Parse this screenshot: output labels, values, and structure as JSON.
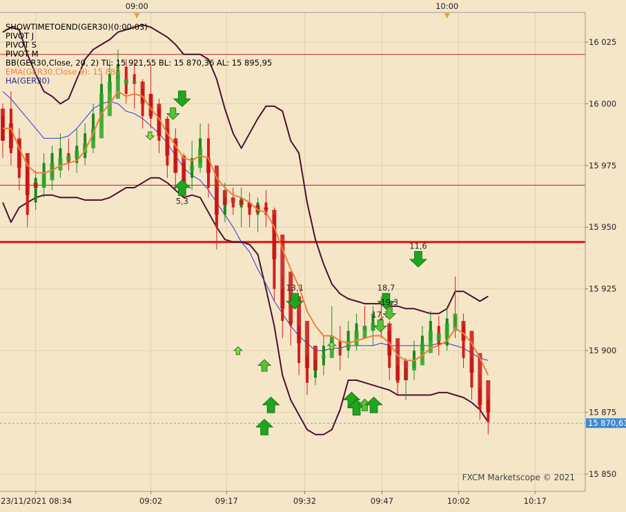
{
  "chart_data": {
    "type": "candlestick",
    "instrument": "GER30",
    "legend": [
      {
        "text": "SHOWTIMETOEND(GER30)(0:00:03)",
        "color": "#000000"
      },
      {
        "text": "PIVOT J",
        "color": "#000000"
      },
      {
        "text": "PIVOT S",
        "color": "#000000"
      },
      {
        "text": "PIVOT M",
        "color": "#000000"
      },
      {
        "text": "BB(GER30,Close, 20, 2)  TL: 15 921,55  BL: 15 870,36  AL: 15 895,95",
        "color": "#000000"
      },
      {
        "text": "EMA(GER30,Close,9): 15 889",
        "color": "#f07f3c"
      },
      {
        "text": "HA(GER30)",
        "color": "#2a2a8a"
      }
    ],
    "watermark": "FXCM Marketscope © 2021",
    "y_ticks": [
      15850,
      15875,
      15900,
      15925,
      15950,
      15975,
      16000,
      16025
    ],
    "y_tick_labels": [
      "15 850",
      "15 875",
      "15 900",
      "15 925",
      "15 950",
      "15 975",
      "16 000",
      "16 025"
    ],
    "ylim": [
      15843,
      16037
    ],
    "x_tick_labels": [
      {
        "label": "23/11/2021 08:34",
        "bar": 4
      },
      {
        "label": "09:02",
        "bar": 18
      },
      {
        "label": "09:17",
        "bar": 27.2
      },
      {
        "label": "09:32",
        "bar": 36.7
      },
      {
        "label": "09:47",
        "bar": 46.1
      },
      {
        "label": "10:02",
        "bar": 55.4
      },
      {
        "label": "10:17",
        "bar": 64.7
      }
    ],
    "session_markers": [
      {
        "label": "09:00",
        "bar": 16.3
      },
      {
        "label": "10:00",
        "bar": 54.0
      }
    ],
    "pivot_lines": [
      {
        "name": "pivot-line-upper",
        "value": 16020,
        "color": "#b02020",
        "width": 1
      },
      {
        "name": "pivot-line-middle",
        "value": 15967,
        "color": "#b02020",
        "width": 1
      },
      {
        "name": "pivot-line-main",
        "value": 15944,
        "color": "#e01010",
        "width": 3
      }
    ],
    "current_price": {
      "value": 15870.61,
      "label": "15 870,61"
    },
    "candles": [
      {
        "o": 15995,
        "h": 16000,
        "l": 15978,
        "c": 15985
      },
      {
        "o": 15998,
        "h": 16005,
        "l": 15975,
        "c": 15980
      },
      {
        "o": 15985,
        "h": 15990,
        "l": 15965,
        "c": 15970
      },
      {
        "o": 15975,
        "h": 15980,
        "l": 15950,
        "c": 15955
      },
      {
        "o": 15960,
        "h": 15973,
        "l": 15957,
        "c": 15970
      },
      {
        "o": 15966,
        "h": 15980,
        "l": 15962,
        "c": 15976
      },
      {
        "o": 15970,
        "h": 15983,
        "l": 15965,
        "c": 15980
      },
      {
        "o": 15975,
        "h": 15988,
        "l": 15970,
        "c": 15982
      },
      {
        "o": 15980,
        "h": 15986,
        "l": 15973,
        "c": 15976
      },
      {
        "o": 15976,
        "h": 15990,
        "l": 15972,
        "c": 15983
      },
      {
        "o": 15978,
        "h": 15992,
        "l": 15975,
        "c": 15988
      },
      {
        "o": 15985,
        "h": 16000,
        "l": 15980,
        "c": 15996
      },
      {
        "o": 15995,
        "h": 16012,
        "l": 15990,
        "c": 16008
      },
      {
        "o": 16005,
        "h": 16018,
        "l": 16000,
        "c": 16012
      },
      {
        "o": 16010,
        "h": 16022,
        "l": 16005,
        "c": 16016
      },
      {
        "o": 16015,
        "h": 16018,
        "l": 16000,
        "c": 16004
      },
      {
        "o": 16012,
        "h": 16018,
        "l": 15998,
        "c": 16008
      },
      {
        "o": 16006,
        "h": 16010,
        "l": 15990,
        "c": 15995
      },
      {
        "o": 16004,
        "h": 16016,
        "l": 15990,
        "c": 15994
      },
      {
        "o": 15998,
        "h": 16002,
        "l": 15980,
        "c": 15985
      },
      {
        "o": 15990,
        "h": 15995,
        "l": 15970,
        "c": 15975
      },
      {
        "o": 15985,
        "h": 15990,
        "l": 15965,
        "c": 15972
      },
      {
        "o": 15976,
        "h": 15980,
        "l": 15962,
        "c": 15968
      },
      {
        "o": 15970,
        "h": 15985,
        "l": 15965,
        "c": 15978
      },
      {
        "o": 15976,
        "h": 15992,
        "l": 15972,
        "c": 15986
      },
      {
        "o": 15986,
        "h": 15992,
        "l": 15962,
        "c": 15966
      },
      {
        "o": 15966,
        "h": 15972,
        "l": 15941,
        "c": 15950
      },
      {
        "o": 15955,
        "h": 15968,
        "l": 15952,
        "c": 15962
      },
      {
        "o": 15960,
        "h": 15966,
        "l": 15955,
        "c": 15958
      },
      {
        "o": 15958,
        "h": 15966,
        "l": 15950,
        "c": 15962
      },
      {
        "o": 15960,
        "h": 15964,
        "l": 15950,
        "c": 15955
      },
      {
        "o": 15955,
        "h": 15962,
        "l": 15948,
        "c": 15960
      },
      {
        "o": 15960,
        "h": 15965,
        "l": 15950,
        "c": 15955
      },
      {
        "o": 15955,
        "h": 15958,
        "l": 15920,
        "c": 15925
      },
      {
        "o": 15925,
        "h": 15930,
        "l": 15905,
        "c": 15912
      },
      {
        "o": 15912,
        "h": 15920,
        "l": 15902,
        "c": 15910
      },
      {
        "o": 15910,
        "h": 15915,
        "l": 15890,
        "c": 15895
      },
      {
        "o": 15898,
        "h": 15905,
        "l": 15882,
        "c": 15887
      },
      {
        "o": 15889,
        "h": 15899,
        "l": 15886,
        "c": 15896
      },
      {
        "o": 15894,
        "h": 15906,
        "l": 15890,
        "c": 15902
      },
      {
        "o": 15902,
        "h": 15918,
        "l": 15897,
        "c": 15905
      },
      {
        "o": 15904,
        "h": 15910,
        "l": 15892,
        "c": 15898
      },
      {
        "o": 15900,
        "h": 15912,
        "l": 15897,
        "c": 15908
      },
      {
        "o": 15905,
        "h": 15915,
        "l": 15900,
        "c": 15911
      },
      {
        "o": 15910,
        "h": 15918,
        "l": 15905,
        "c": 15908
      },
      {
        "o": 15908,
        "h": 15918,
        "l": 15902,
        "c": 15915
      },
      {
        "o": 15913,
        "h": 15922,
        "l": 15905,
        "c": 15908
      },
      {
        "o": 15908,
        "h": 15912,
        "l": 15888,
        "c": 15893
      },
      {
        "o": 15894,
        "h": 15900,
        "l": 15882,
        "c": 15887
      },
      {
        "o": 15888,
        "h": 15897,
        "l": 15880,
        "c": 15893
      },
      {
        "o": 15893,
        "h": 15904,
        "l": 15888,
        "c": 15900
      },
      {
        "o": 15900,
        "h": 15910,
        "l": 15895,
        "c": 15906
      },
      {
        "o": 15904,
        "h": 15916,
        "l": 15900,
        "c": 15912
      },
      {
        "o": 15910,
        "h": 15914,
        "l": 15898,
        "c": 15902
      },
      {
        "o": 15902,
        "h": 15918,
        "l": 15900,
        "c": 15913
      },
      {
        "o": 15914,
        "h": 15930,
        "l": 15905,
        "c": 15910
      },
      {
        "o": 15910,
        "h": 15915,
        "l": 15893,
        "c": 15897
      },
      {
        "o": 15897,
        "h": 15903,
        "l": 15880,
        "c": 15885
      },
      {
        "o": 15885,
        "h": 15890,
        "l": 15872,
        "c": 15876
      },
      {
        "o": 15880,
        "h": 15882,
        "l": 15866,
        "c": 15871
      }
    ],
    "heikin_ashi": [
      {
        "bar": 0,
        "o": 15998,
        "c": 15985
      },
      {
        "bar": 1,
        "o": 15992,
        "c": 15982
      },
      {
        "bar": 2,
        "o": 15986,
        "c": 15974
      },
      {
        "bar": 3,
        "o": 15980,
        "c": 15963
      },
      {
        "bar": 4,
        "o": 15968,
        "c": 15966
      },
      {
        "bar": 5,
        "o": 15966,
        "c": 15972
      },
      {
        "bar": 6,
        "o": 15969,
        "c": 15976
      },
      {
        "bar": 7,
        "o": 15973,
        "c": 15978
      },
      {
        "bar": 8,
        "o": 15977,
        "c": 15979
      },
      {
        "bar": 9,
        "o": 15978,
        "c": 15981
      },
      {
        "bar": 10,
        "o": 15980,
        "c": 15984
      },
      {
        "bar": 11,
        "o": 15982,
        "c": 15990
      },
      {
        "bar": 12,
        "o": 15986,
        "c": 16004
      },
      {
        "bar": 13,
        "o": 15995,
        "c": 16009
      },
      {
        "bar": 14,
        "o": 16002,
        "c": 16013
      },
      {
        "bar": 15,
        "o": 16008,
        "c": 16010
      },
      {
        "bar": 16,
        "o": 16009,
        "c": 16009
      },
      {
        "bar": 17,
        "o": 16009,
        "c": 16000
      },
      {
        "bar": 18,
        "o": 16004,
        "c": 15995
      },
      {
        "bar": 19,
        "o": 16000,
        "c": 15987
      },
      {
        "bar": 20,
        "o": 15994,
        "c": 15979
      },
      {
        "bar": 21,
        "o": 15986,
        "c": 15972
      },
      {
        "bar": 22,
        "o": 15979,
        "c": 15968
      },
      {
        "bar": 23,
        "o": 15973,
        "c": 15975
      },
      {
        "bar": 24,
        "o": 15974,
        "c": 15982
      },
      {
        "bar": 25,
        "o": 15978,
        "c": 15972
      },
      {
        "bar": 26,
        "o": 15975,
        "c": 15955
      },
      {
        "bar": 27,
        "o": 15965,
        "c": 15959
      },
      {
        "bar": 28,
        "o": 15962,
        "c": 15960
      },
      {
        "bar": 29,
        "o": 15961,
        "c": 15959
      },
      {
        "bar": 30,
        "o": 15960,
        "c": 15958
      },
      {
        "bar": 31,
        "o": 15959,
        "c": 15956
      },
      {
        "bar": 32,
        "o": 15958,
        "c": 15957
      },
      {
        "bar": 33,
        "o": 15957,
        "c": 15937
      },
      {
        "bar": 34,
        "o": 15947,
        "c": 15917
      },
      {
        "bar": 35,
        "o": 15932,
        "c": 15911
      },
      {
        "bar": 36,
        "o": 15922,
        "c": 15903
      },
      {
        "bar": 37,
        "o": 15912,
        "c": 15893
      },
      {
        "bar": 38,
        "o": 15902,
        "c": 15892
      },
      {
        "bar": 39,
        "o": 15897,
        "c": 15898
      },
      {
        "bar": 40,
        "o": 15897,
        "c": 15906
      },
      {
        "bar": 41,
        "o": 15901,
        "c": 15901
      },
      {
        "bar": 42,
        "o": 15901,
        "c": 15904
      },
      {
        "bar": 43,
        "o": 15902,
        "c": 15908
      },
      {
        "bar": 44,
        "o": 15905,
        "c": 15910
      },
      {
        "bar": 45,
        "o": 15908,
        "c": 15911
      },
      {
        "bar": 46,
        "o": 15910,
        "c": 15912
      },
      {
        "bar": 47,
        "o": 15911,
        "c": 15898
      },
      {
        "bar": 48,
        "o": 15905,
        "c": 15888
      },
      {
        "bar": 49,
        "o": 15896,
        "c": 15888
      },
      {
        "bar": 50,
        "o": 15892,
        "c": 15896
      },
      {
        "bar": 51,
        "o": 15894,
        "c": 15903
      },
      {
        "bar": 52,
        "o": 15899,
        "c": 15908
      },
      {
        "bar": 53,
        "o": 15904,
        "c": 15907
      },
      {
        "bar": 54,
        "o": 15905,
        "c": 15911
      },
      {
        "bar": 55,
        "o": 15908,
        "c": 15915
      },
      {
        "bar": 56,
        "o": 15912,
        "c": 15904
      },
      {
        "bar": 57,
        "o": 15908,
        "c": 15891
      },
      {
        "bar": 58,
        "o": 15899,
        "c": 15878
      },
      {
        "bar": 59,
        "o": 15888,
        "c": 15875
      }
    ],
    "bb_upper": [
      16029,
      16031,
      16030,
      16020,
      16012,
      16005,
      16003,
      16000,
      16002,
      16010,
      16018,
      16022,
      16024,
      16026,
      16029,
      16030,
      16031,
      16032,
      16031,
      16029,
      16027,
      16024,
      16020,
      16020,
      16020,
      16018,
      16010,
      15998,
      15988,
      15982,
      15988,
      15994,
      15999,
      15999,
      15997,
      15985,
      15980,
      15960,
      15945,
      15935,
      15927,
      15923,
      15921,
      15920,
      15919,
      15919,
      15919,
      15918,
      15918,
      15917,
      15917,
      15916,
      15915,
      15915,
      15917,
      15924,
      15924,
      15922,
      15920,
      15922
    ],
    "bb_lower": [
      15960,
      15952,
      15958,
      15960,
      15962,
      15963,
      15963,
      15962,
      15962,
      15962,
      15961,
      15961,
      15961,
      15962,
      15964,
      15966,
      15966,
      15968,
      15970,
      15970,
      15968,
      15965,
      15962,
      15963,
      15962,
      15956,
      15950,
      15945,
      15944,
      15944,
      15943,
      15939,
      15925,
      15910,
      15890,
      15880,
      15874,
      15868,
      15866,
      15866,
      15868,
      15876,
      15888,
      15888,
      15887,
      15886,
      15885,
      15884,
      15882,
      15882,
      15882,
      15882,
      15882,
      15883,
      15883,
      15882,
      15881,
      15879,
      15876,
      15871
    ],
    "ema9": [
      15990,
      15990,
      15982,
      15975,
      15972,
      15972,
      15973,
      15975,
      15976,
      15977,
      15981,
      15988,
      15996,
      16000,
      16005,
      16003,
      16004,
      16003,
      15998,
      15994,
      15988,
      15983,
      15978,
      15977,
      15979,
      15978,
      15970,
      15966,
      15963,
      15962,
      15960,
      15957,
      15956,
      15950,
      15941,
      15933,
      15926,
      15916,
      15910,
      15906,
      15906,
      15904,
      15903,
      15904,
      15905,
      15906,
      15906,
      15903,
      15898,
      15896,
      15896,
      15898,
      15901,
      15902,
      15904,
      15909,
      15907,
      15903,
      15897,
      15890
    ],
    "sma": [
      16005,
      16002,
      15998,
      15994,
      15990,
      15986,
      15986,
      15986,
      15987,
      15990,
      15994,
      15998,
      16000,
      16001,
      16000,
      15997,
      15996,
      15994,
      15991,
      15988,
      15984,
      15979,
      15974,
      15971,
      15969,
      15965,
      15960,
      15955,
      15950,
      15944,
      15940,
      15933,
      15927,
      15920,
      15915,
      15910,
      15906,
      15903,
      15900,
      15900,
      15901,
      15901,
      15902,
      15902,
      15902,
      15902,
      15903,
      15902,
      15902,
      15902,
      15902,
      15902,
      15902,
      15903,
      15903,
      15902,
      15901,
      15899,
      15897,
      15896
    ],
    "signals": [
      {
        "bar": 21.8,
        "dir": "up",
        "size": "medium",
        "value": 15966,
        "label": "5,3"
      },
      {
        "bar": 21.8,
        "dir": "down",
        "size": "medium",
        "value": 16002,
        "label": ""
      },
      {
        "bar": 20.7,
        "dir": "down",
        "size": "small",
        "value": 15996,
        "label": ""
      },
      {
        "bar": 17.9,
        "dir": "down",
        "size": "tiny",
        "value": 15987,
        "label": ""
      },
      {
        "bar": 28.6,
        "dir": "up",
        "size": "tiny",
        "value": 15900,
        "label": ""
      },
      {
        "bar": 31.8,
        "dir": "up",
        "size": "small",
        "value": 15894,
        "label": ""
      },
      {
        "bar": 32.6,
        "dir": "up",
        "size": "medium",
        "value": 15878,
        "label": ""
      },
      {
        "bar": 31.8,
        "dir": "up",
        "size": "medium",
        "value": 15869,
        "label": ""
      },
      {
        "bar": 35.5,
        "dir": "down",
        "size": "medium",
        "value": 15920,
        "label": "13,1"
      },
      {
        "bar": 40.0,
        "dir": "up",
        "size": "tiny",
        "value": 15902,
        "label": ""
      },
      {
        "bar": 42.4,
        "dir": "up",
        "size": "medium",
        "value": 15880,
        "label": ""
      },
      {
        "bar": 43.0,
        "dir": "up",
        "size": "medium",
        "value": 15877,
        "label": ""
      },
      {
        "bar": 44.0,
        "dir": "up",
        "size": "small",
        "value": 15878,
        "label": ""
      },
      {
        "bar": 45.1,
        "dir": "up",
        "size": "medium",
        "value": 15878,
        "label": ""
      },
      {
        "bar": 45.9,
        "dir": "down",
        "size": "small",
        "value": 15910,
        "label": "17,7"
      },
      {
        "bar": 46.6,
        "dir": "down",
        "size": "medium",
        "value": 15920,
        "label": "18,7"
      },
      {
        "bar": 47.0,
        "dir": "down",
        "size": "small",
        "value": 15915,
        "label": "19,3"
      },
      {
        "bar": 50.5,
        "dir": "down",
        "size": "medium",
        "value": 15937,
        "label": "11,6"
      }
    ]
  }
}
